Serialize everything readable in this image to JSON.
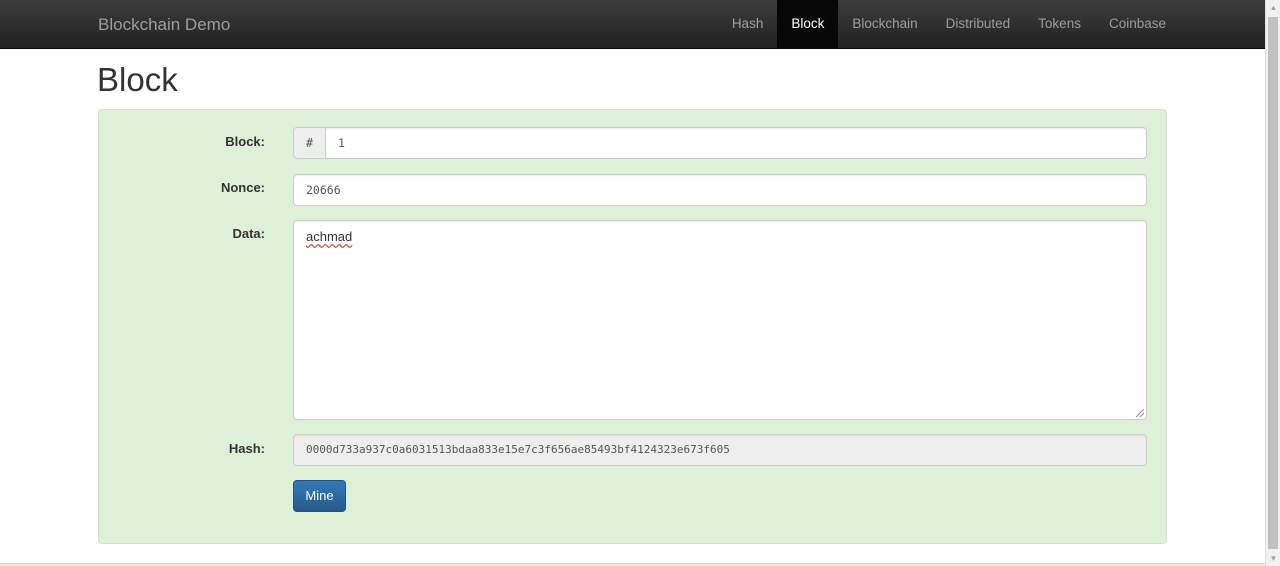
{
  "navbar": {
    "brand": "Blockchain Demo",
    "items": [
      {
        "label": "Hash",
        "active": false
      },
      {
        "label": "Block",
        "active": true
      },
      {
        "label": "Blockchain",
        "active": false
      },
      {
        "label": "Distributed",
        "active": false
      },
      {
        "label": "Tokens",
        "active": false
      },
      {
        "label": "Coinbase",
        "active": false
      }
    ]
  },
  "page": {
    "title": "Block"
  },
  "form": {
    "block_label": "Block:",
    "block_prefix": "#",
    "block_value": "1",
    "nonce_label": "Nonce:",
    "nonce_value": "20666",
    "data_label": "Data:",
    "data_value": "achmad",
    "hash_label": "Hash:",
    "hash_value": "0000d733a937c0a6031513bdaa833e15e7c3f656ae85493bf4124323e673f605",
    "mine_label": "Mine"
  },
  "colors": {
    "navbar_bg": "#222222",
    "well_success_bg": "#dff0d8",
    "primary_button": "#337ab7"
  },
  "icons": {
    "scroll_up": "scroll-up-arrow-icon",
    "scroll_down": "scroll-down-arrow-icon",
    "resize": "resize-grip-icon"
  }
}
